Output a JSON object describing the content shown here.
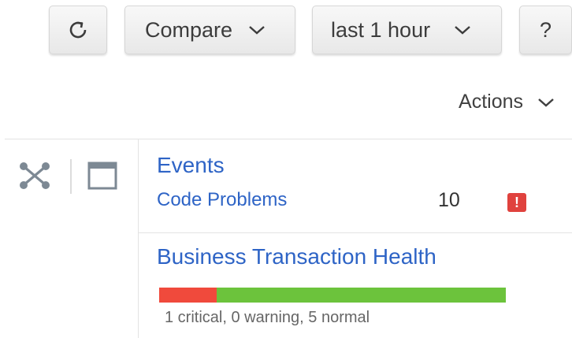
{
  "toolbar": {
    "refresh_icon": "refresh-icon",
    "compare_label": "Compare",
    "time_range_label": "last 1 hour",
    "help_label": "?"
  },
  "actions": {
    "label": "Actions"
  },
  "tools": {
    "expand_icon": "expand-arrows-icon",
    "window_icon": "window-icon"
  },
  "events": {
    "title": "Events",
    "items": [
      {
        "label": "Code Problems",
        "count": "10",
        "status": "critical",
        "badge_symbol": "!"
      }
    ]
  },
  "business_transaction_health": {
    "title": "Business Transaction Health",
    "critical": 1,
    "warning": 0,
    "normal": 5,
    "summary": "1 critical, 0 warning, 5 normal"
  },
  "colors": {
    "link": "#2e64c6",
    "critical": "#f04a3c",
    "warning": "#f5a623",
    "normal": "#6cc33c",
    "badge": "#e0423e"
  }
}
